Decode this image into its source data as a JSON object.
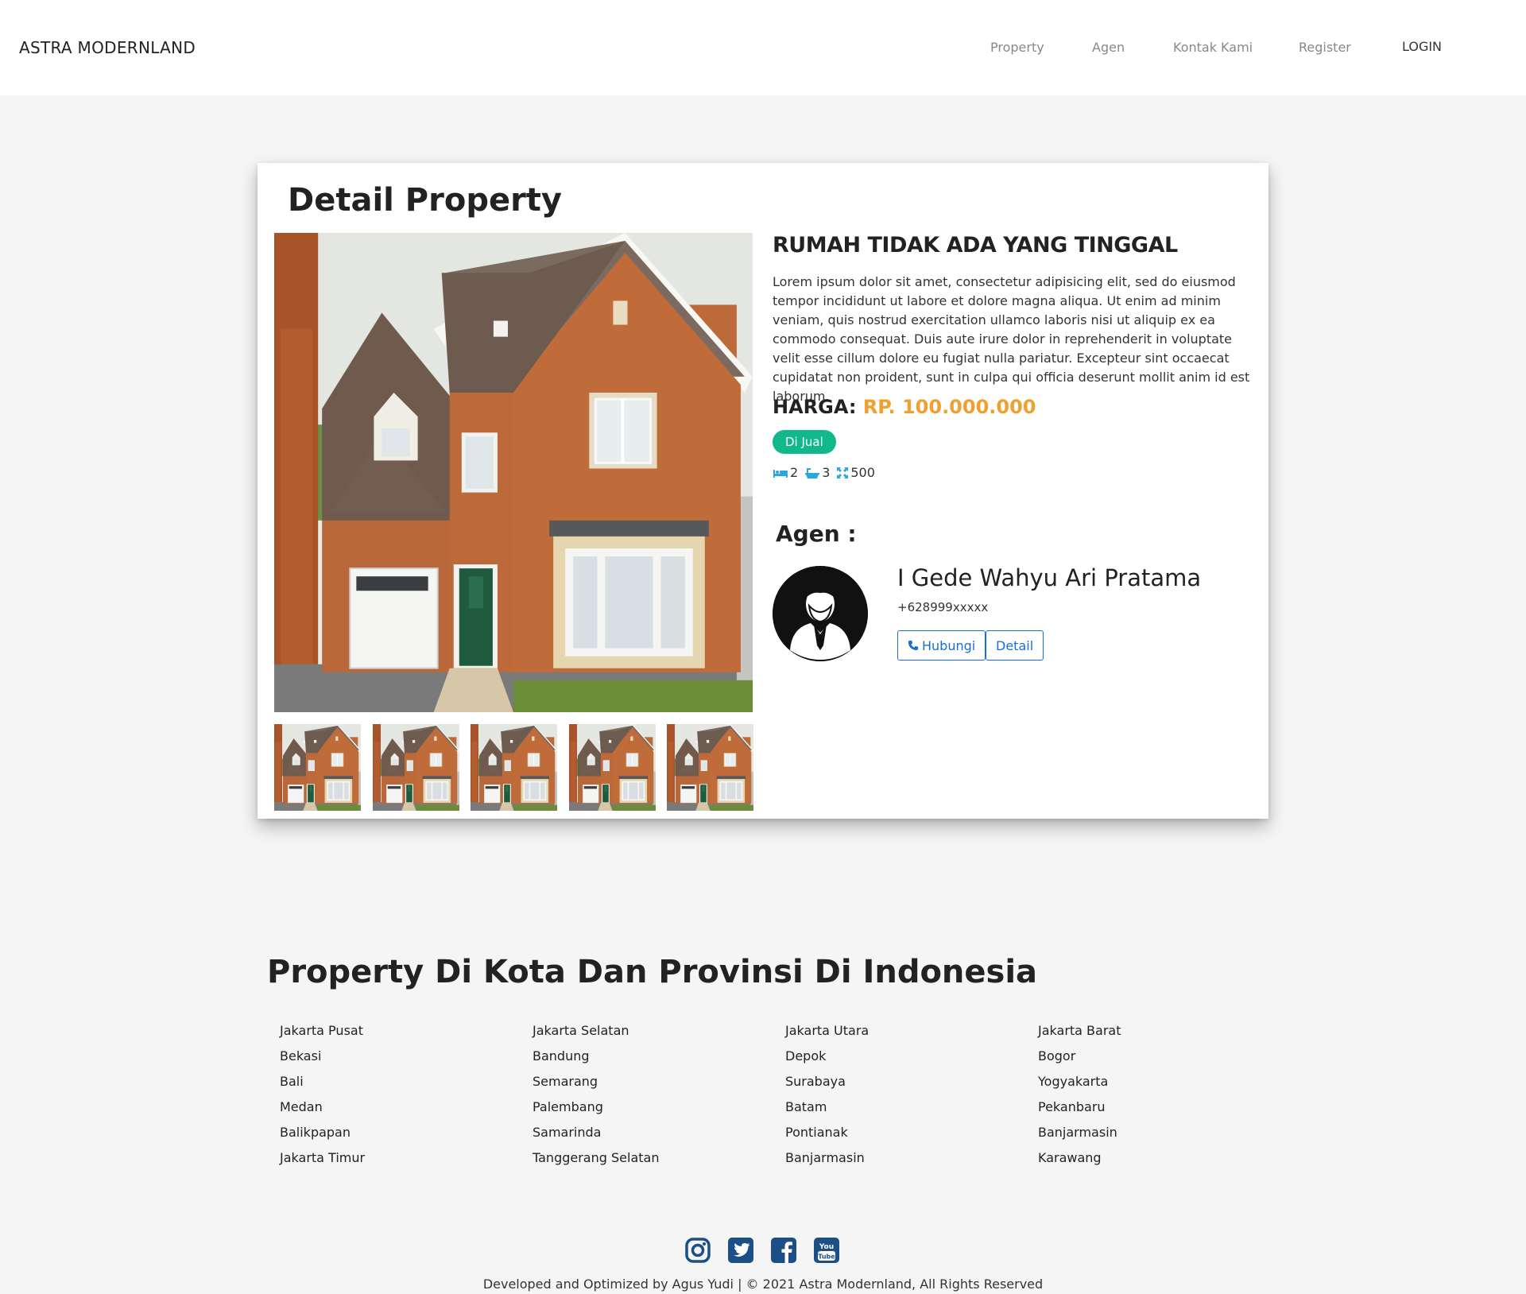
{
  "nav": {
    "brand": "ASTRA MODERNLAND",
    "links": [
      "Property",
      "Agen",
      "Kontak Kami",
      "Register"
    ],
    "login": "LOGIN"
  },
  "card": {
    "title": "Detail Property",
    "property": {
      "name": "RUMAH TIDAK ADA YANG TINGGAL",
      "description": "Lorem ipsum dolor sit amet, consectetur adipisicing elit, sed do eiusmod tempor incididunt ut labore et dolore magna aliqua. Ut enim ad minim veniam, quis nostrud exercitation ullamco laboris nisi ut aliquip ex ea commodo consequat. Duis aute irure dolor in reprehenderit in voluptate velit esse cillum dolore eu fugiat nulla pariatur. Excepteur sint occaecat cupidatat non proident, sunt in culpa qui officia deserunt mollit anim id est laborum.",
      "price_label": "HARGA:",
      "price_value": "RP. 100.000.000",
      "status_badge": "Di Jual",
      "bedrooms": "2",
      "bathrooms": "3",
      "area": "500"
    },
    "agent": {
      "heading": "Agen :",
      "name": "I Gede Wahyu Ari Pratama",
      "phone": "+628999xxxxx",
      "contact_button": "Hubungi",
      "detail_button": "Detail"
    }
  },
  "cities": {
    "title": "Property Di Kota Dan Provinsi Di Indonesia",
    "columns": [
      [
        "Jakarta Pusat",
        "Bekasi",
        "Bali",
        "Medan",
        "Balikpapan",
        "Jakarta Timur"
      ],
      [
        "Jakarta Selatan",
        "Bandung",
        "Semarang",
        "Palembang",
        "Samarinda",
        "Tanggerang Selatan"
      ],
      [
        "Jakarta Utara",
        "Depok",
        "Surabaya",
        "Batam",
        "Pontianak",
        "Banjarmasin"
      ],
      [
        "Jakarta Barat",
        "Bogor",
        "Yogyakarta",
        "Pekanbaru",
        "Banjarmasin",
        "Karawang"
      ]
    ]
  },
  "footer": {
    "social_icons": [
      "instagram-icon",
      "twitter-icon",
      "facebook-icon",
      "youtube-icon"
    ],
    "text": "Developed and Optimized by Agus Yudi | © 2021 Astra Modernland, All Rights Reserved"
  },
  "colors": {
    "accent_price": "#f0a030",
    "badge_green": "#11b88b",
    "button_blue": "#1a6ed8",
    "feature_icon_blue": "#2aa7e0",
    "social_navy": "#1c4f86"
  }
}
